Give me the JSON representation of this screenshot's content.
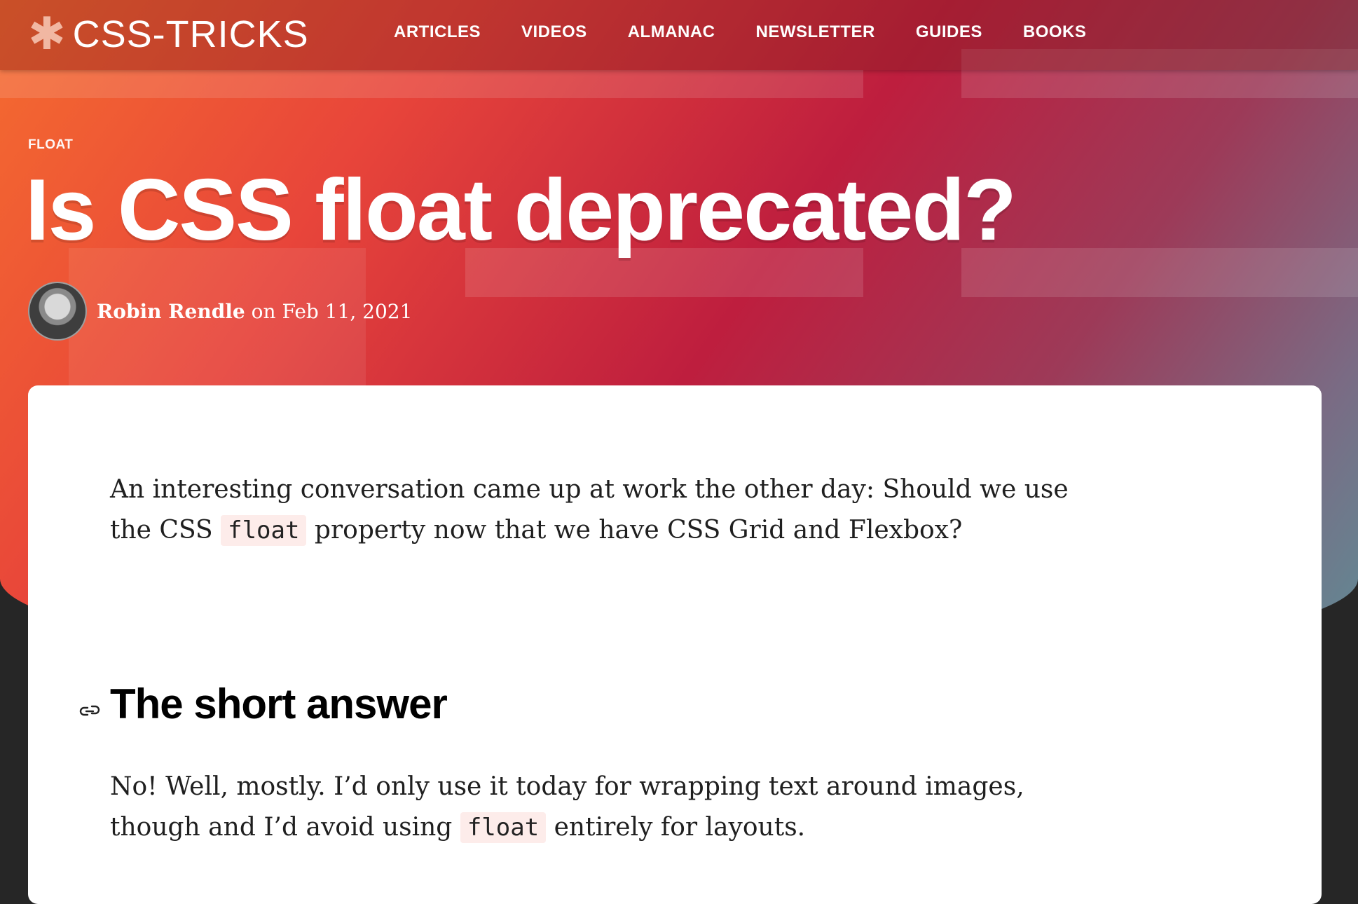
{
  "site": {
    "logo_text": "CSS-TRICKS",
    "logo_icon": "asterisk-icon"
  },
  "nav": {
    "items": [
      "ARTICLES",
      "VIDEOS",
      "ALMANAC",
      "NEWSLETTER",
      "GUIDES",
      "BOOKS"
    ]
  },
  "article": {
    "category": "FLOAT",
    "title": "Is CSS float deprecated?",
    "author": "Robin Rendle",
    "date_prefix": "on",
    "date": "Feb 11, 2021",
    "intro": {
      "part1": "An interesting conversation came up at work the other day: Should we use the CSS",
      "code": "float",
      "part2": "property now that we have CSS Grid and Flexbox?"
    },
    "section_heading": "The short answer",
    "answer": {
      "part1": "No! Well, mostly. I’d only use it today for wrapping text around images, though and I’d avoid using",
      "code": "float",
      "part2": "entirely for layouts."
    }
  },
  "colors": {
    "hero_start": "#f56c2f",
    "hero_mid": "#be1e3e",
    "hero_end": "#5f8c95",
    "code_bg": "#fdecea"
  }
}
